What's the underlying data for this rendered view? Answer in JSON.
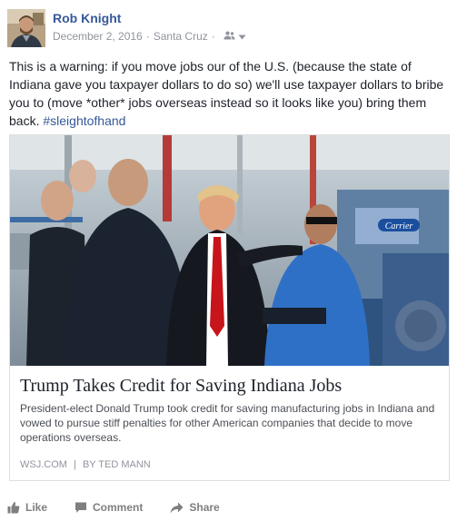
{
  "post": {
    "author": "Rob Knight",
    "date": "December 2, 2016",
    "separator": "·",
    "location": "Santa Cruz",
    "audience_icon": "friends-icon",
    "menu_icon": "chevron-down-icon",
    "text_main": "This is a warning: if you move jobs our of the U.S. (because the state of Indiana gave you taxpayer dollars to do so) we'll use taxpayer dollars to bribe you to (move *other* jobs overseas instead so it looks like you) bring them back. ",
    "hashtag": "#sleightofhand"
  },
  "link_card": {
    "image": "news-photo",
    "image_sign": "Carrier",
    "title": "Trump Takes Credit for Saving Indiana Jobs",
    "description": "President-elect Donald Trump took credit for saving manufacturing jobs in Indiana and vowed to pursue stiff penalties for other American companies that decide to move operations overseas.",
    "source": "WSJ.COM",
    "source_sep": "|",
    "byline": "BY TED MANN"
  },
  "actions": {
    "like": "Like",
    "comment": "Comment",
    "share": "Share",
    "like_icon": "thumbs-up-icon",
    "comment_icon": "comment-icon",
    "share_icon": "share-arrow-icon"
  },
  "colors": {
    "link_blue": "#365899",
    "meta_gray": "#90949c",
    "text": "#1d2129",
    "border": "#dddfe2"
  }
}
